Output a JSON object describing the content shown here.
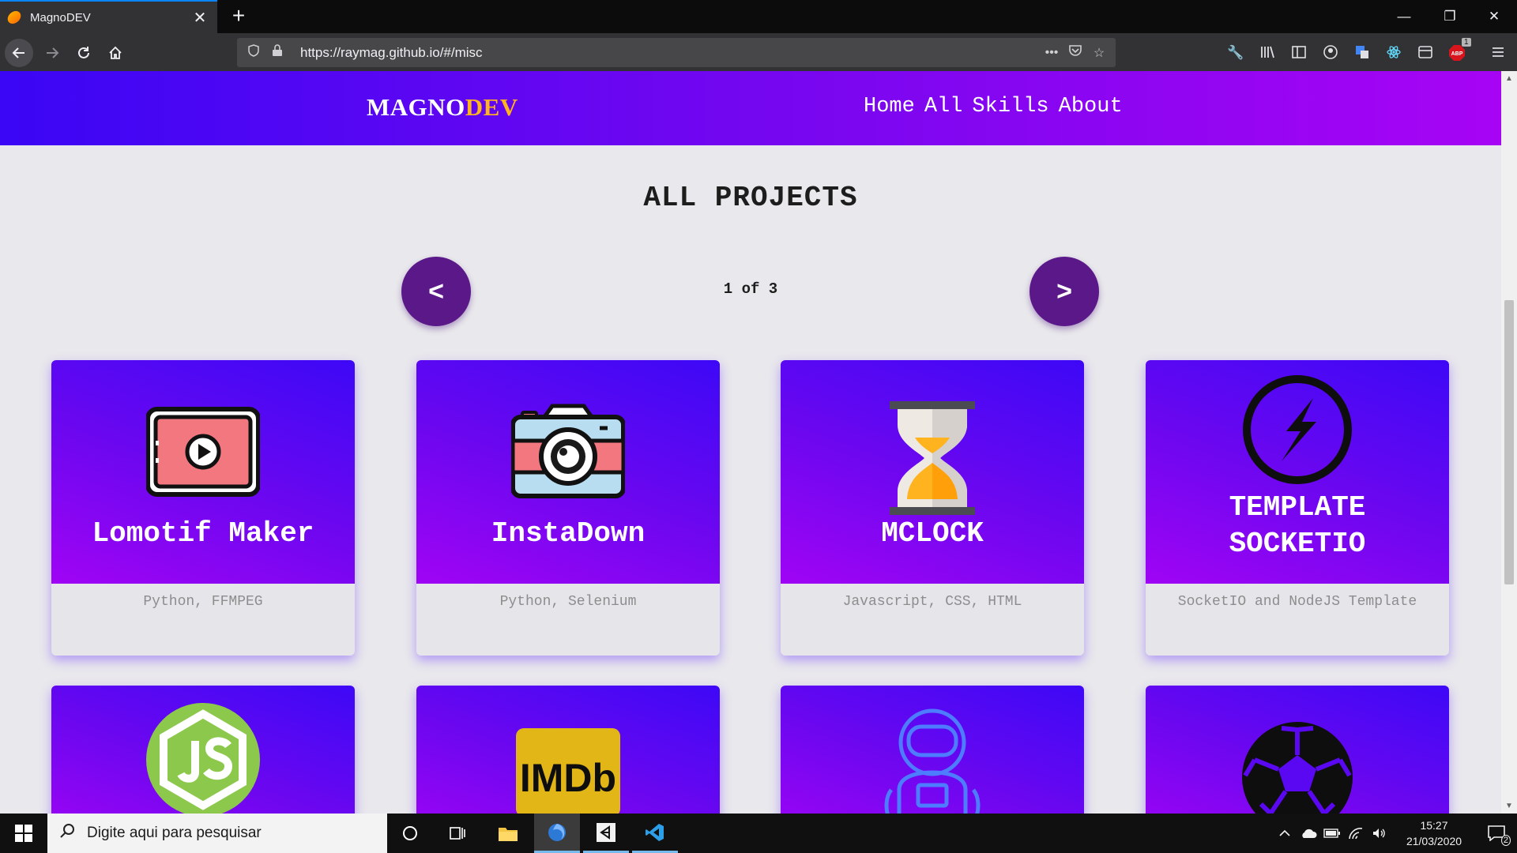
{
  "browser": {
    "tab_title": "MagnoDEV",
    "tab_close": "✕",
    "new_tab": "+",
    "url": "https://raymag.github.io/#/misc",
    "window_controls": {
      "minimize": "—",
      "restore": "❐",
      "close": "✕"
    },
    "adblock_badge": "1"
  },
  "site": {
    "logo_part1": "MAGNO",
    "logo_part2": "DEV",
    "nav": [
      "Home",
      "All",
      "Skills",
      "About"
    ],
    "section_title": "ALL PROJECTS",
    "pager": {
      "prev": "<",
      "next": ">",
      "text": "1 of 3"
    },
    "projects": [
      {
        "title": "Lomotif Maker",
        "description": "Python, FFMPEG",
        "icon": "video-play-icon"
      },
      {
        "title": "InstaDown",
        "description": "Python, Selenium",
        "icon": "camera-icon"
      },
      {
        "title": "MCLOCK",
        "description": "Javascript, CSS, HTML",
        "icon": "hourglass-icon"
      },
      {
        "title_line1": "TEMPLATE",
        "title_line2": "SOCKETIO",
        "description": "SocketIO and NodeJS Template",
        "icon": "socketio-icon"
      }
    ],
    "projects_row2": [
      {
        "icon": "nodejs-icon"
      },
      {
        "icon": "imdb-icon",
        "icon_text": "IMDb"
      },
      {
        "icon": "astronaut-icon"
      },
      {
        "icon": "soccer-ball-icon"
      }
    ],
    "colors": {
      "header_start": "#3a06f5",
      "header_end": "#a704f4",
      "logo_accent": "#ffb31e",
      "pager_button": "#5a1889"
    }
  },
  "taskbar": {
    "search_placeholder": "Digite aqui para pesquisar",
    "time": "15:27",
    "date": "21/03/2020",
    "notifications_count": "2"
  }
}
